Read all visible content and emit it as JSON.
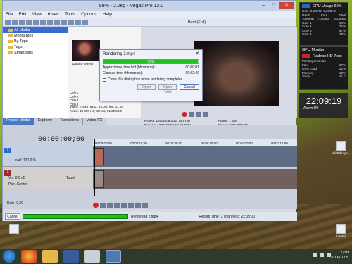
{
  "window": {
    "title": "99% - 2.veg - Vegas Pro 12.0",
    "menus": [
      "File",
      "Edit",
      "View",
      "Insert",
      "Tools",
      "Options",
      "Help"
    ]
  },
  "preview_quality": "Best (Full)",
  "explorer": {
    "items": [
      "All Media",
      "Media Bins",
      "By Type",
      "Tags",
      "Smart Bins"
    ],
    "selected_index": 0
  },
  "media": {
    "clip_caption": "Fekete városi...",
    "shortcuts": [
      "Ctrl+1",
      "Ctrl+2",
      "Ctrl+3",
      "Ctrl+4"
    ],
    "properties": [
      "Video: 720x576x32; 25,000 fps; 01:15",
      "Audio: 48 000 Hz; Stereo; 01:09:58:0"
    ]
  },
  "tabs": [
    "Project Media",
    "Explorer",
    "Transitions",
    "Video FX"
  ],
  "active_tab": 0,
  "preview": {
    "project": "Project: 1920x1080x32; 29,970p",
    "preview": "Preview: 1920x1080x32; 29,970p",
    "frame_label": "Frame:",
    "frame_value": "1 518",
    "display_label": "Display:",
    "display_value": "366x207x32"
  },
  "render_dialog": {
    "title": "Rendering 2.mp4",
    "progress_text": "99%",
    "progress_fraction": 0.99,
    "approx_label": "Approximate time left (hh:mm:ss):",
    "approx_value": "00:00:01",
    "elapsed_label": "Elapsed time (hh:mm:ss):",
    "elapsed_value": "00:02:49",
    "checkbox_label": "Close this dialog box when rendering completes",
    "buttons": [
      "Open",
      "Open Folder",
      "Cancel"
    ]
  },
  "timeline": {
    "time": "00:00:00;00",
    "ruler": [
      "00:00:00;00",
      "00:00:15;00",
      "00:00:30;00",
      "00:00:45;00",
      "00:01:00;00",
      "00:01:15;00"
    ],
    "video_track": {
      "number": "1",
      "level": "Level: 100,0 %"
    },
    "audio_track": {
      "number": "2",
      "vol": "Vol:",
      "vol_value": "0,0 dB",
      "pan": "Pan:",
      "pan_value": "Center",
      "touch": "Touch"
    },
    "rate": "Rate: 0,00"
  },
  "status": {
    "cancel": "Cancel",
    "progress_fraction": 1.0,
    "rendering": "Rendering 2.mp4",
    "record_time": "Record Time (2 channels): 22:09:00"
  },
  "cpu_gadget": {
    "title": "CPU Usage 69%",
    "rows": [
      [
        "Core i5-3470K 3,20GHz",
        ""
      ],
      [
        "Used",
        "Free",
        "Total"
      ],
      [
        "1080MB",
        "7020MB",
        "8100MB"
      ],
      [
        "Core 1",
        "64%"
      ],
      [
        "Core 2",
        "71%"
      ],
      [
        "Core 3",
        "67%"
      ],
      [
        "Core 4",
        "72%"
      ]
    ]
  },
  "gpu_gadget": {
    "title": "GPU Monitor",
    "model": "Radeon HD 7xxx",
    "rows": [
      [
        "PCI-Express x16",
        ""
      ],
      [
        "Fan",
        "27%"
      ],
      [
        "GPU Load",
        "21%"
      ],
      [
        "Memory",
        "13%"
      ],
      [
        "Temp",
        "45 C"
      ]
    ]
  },
  "clock": {
    "time": "22:09:19",
    "sub": "Alarm Off"
  },
  "desktop_icons": [
    "ollottdenye...",
    "Lomtár"
  ],
  "tray": {
    "time": "22:09",
    "date": "2014.01.05."
  },
  "colors": {
    "accent": "#4b78c6",
    "progress": "#1fc11f",
    "close": "#c9463d"
  }
}
